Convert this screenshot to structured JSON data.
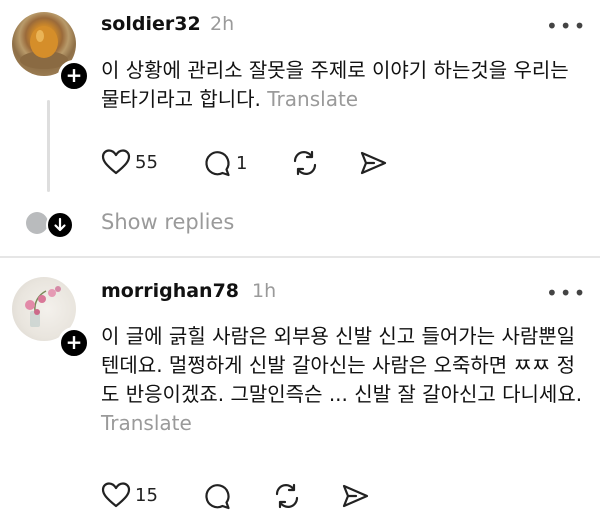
{
  "posts": [
    {
      "username": "soldier32",
      "time": "2h",
      "text": "이 상황에 관리소 잘못을 주제로 이야기 하는것을 우리는 물타기라고 합니다. ",
      "translate": "Translate",
      "likes": "55",
      "replies": "1",
      "icons": [
        "heart-icon",
        "comment-icon",
        "repost-icon",
        "share-icon"
      ]
    },
    {
      "username": "morrighan78",
      "time": "1h",
      "text": "이 글에 긁힐 사람은 외부용 신발 신고 들어가는 사람뿐일텐데요. 멀쩡하게 신발 갈아신는 사람은 오죽하면 ㅉㅉ 정도 반응이겠죠. 그말인즉슨 ... 신발 잘 갈아신고 다니세요. ",
      "translate": "Translate",
      "likes": "15",
      "icons": [
        "heart-icon",
        "comment-icon",
        "repost-icon",
        "share-icon"
      ]
    }
  ],
  "show_replies": "Show replies",
  "more_label": "•••"
}
